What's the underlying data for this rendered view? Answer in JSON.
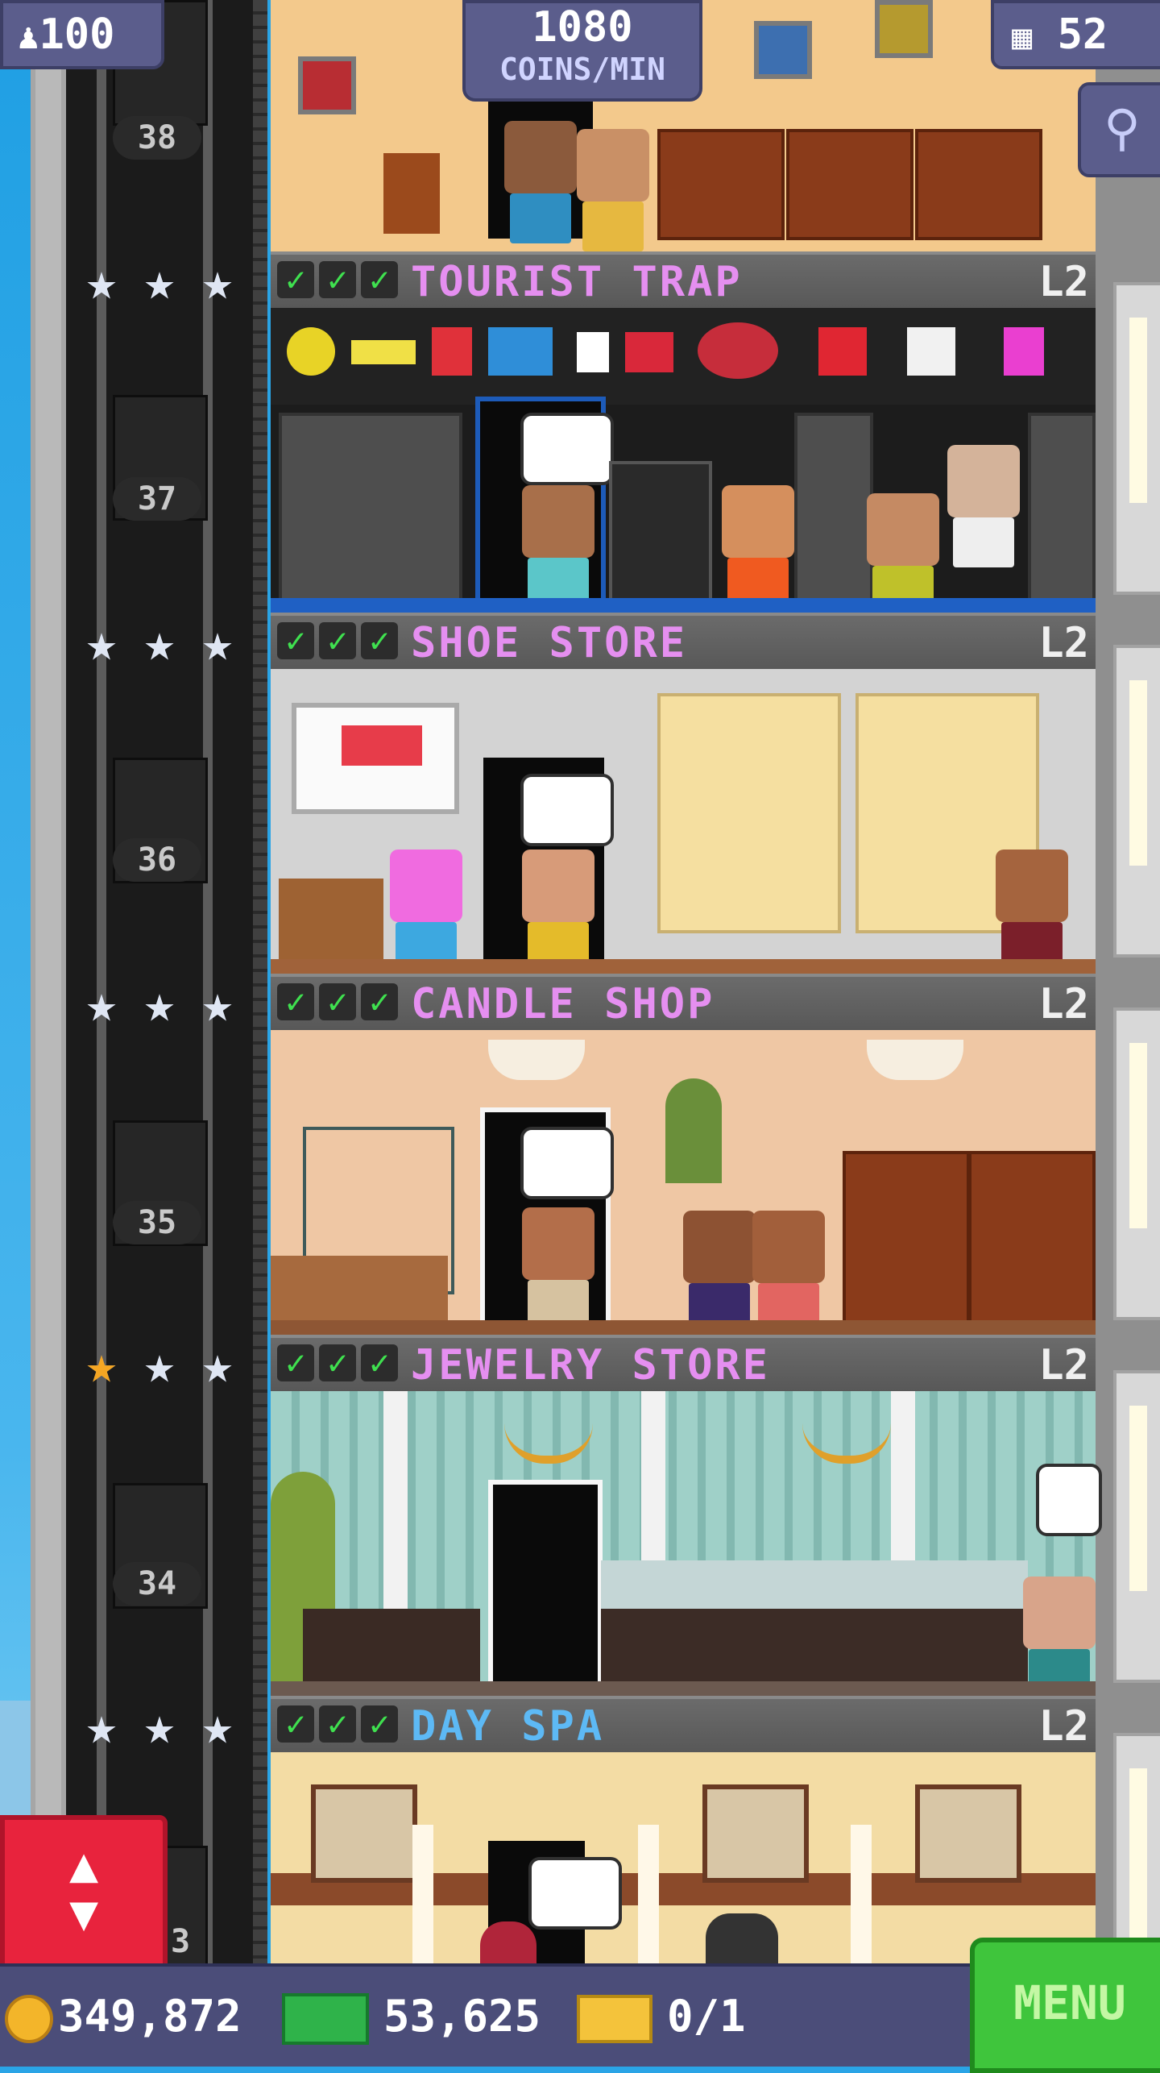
{
  "hud": {
    "population": "100",
    "coins_rate": "1080",
    "coins_rate_label": "COINS/MIN",
    "floor_count": "52"
  },
  "shaft_floors": [
    "38",
    "37",
    "36",
    "35",
    "34",
    "3"
  ],
  "floors": [
    {
      "name": "TOURIST TRAP",
      "level": "L2",
      "checks": 3
    },
    {
      "name": "SHOE STORE",
      "level": "L2",
      "checks": 3
    },
    {
      "name": "CANDLE SHOP",
      "level": "L2",
      "checks": 3
    },
    {
      "name": "JEWELRY STORE",
      "level": "L2",
      "checks": 3
    },
    {
      "name": "DAY SPA",
      "level": "L2",
      "checks": 3
    }
  ],
  "elevator_stars": [
    {
      "gold": 0
    },
    {
      "gold": 0
    },
    {
      "gold": 0
    },
    {
      "gold": 1
    },
    {
      "gold": 0
    }
  ],
  "bottom": {
    "coins": "349,872",
    "bux": "53,625",
    "tickets": "0/1",
    "menu_label": "MENU"
  },
  "icons": {
    "population": "person-icon",
    "floors": "building-icon",
    "search": "magnifier-icon",
    "elevator": "up-down-arrows-icon",
    "check": "checkmark-icon",
    "star": "star-icon",
    "coin": "coin-icon",
    "bux": "bux-icon",
    "ticket": "vip-ticket-icon"
  },
  "colors": {
    "floor_name": "#e58ff0",
    "spa_name": "#5db9f5",
    "check": "#3fe04f",
    "hud_bg": "#5b5d8c",
    "elevator_button": "#e8233d",
    "menu_button": "#3fc53c"
  }
}
